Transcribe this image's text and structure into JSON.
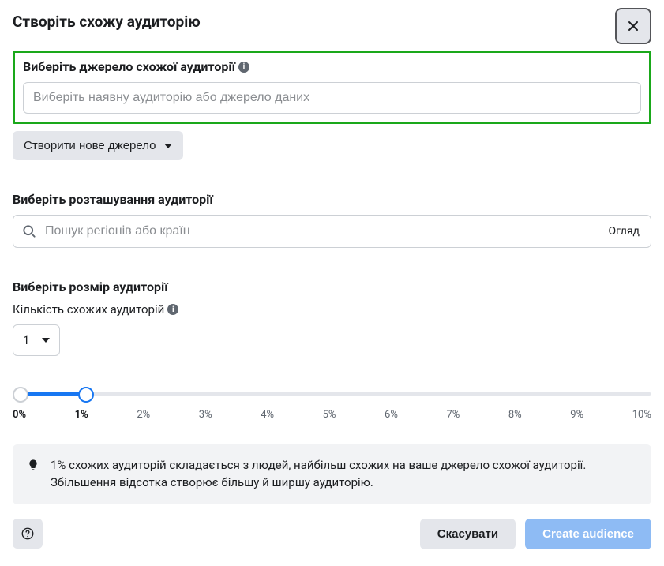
{
  "header": {
    "title": "Створіть схожу аудиторію"
  },
  "source": {
    "label": "Виберіть джерело схожої аудиторії",
    "placeholder": "Виберіть наявну аудиторію або джерело даних",
    "create_new_label": "Створити нове джерело"
  },
  "location": {
    "label": "Виберіть розташування аудиторії",
    "placeholder": "Пошук регіонів або країн",
    "browse_label": "Огляд"
  },
  "size": {
    "label": "Виберіть розмір аудиторії",
    "count_label": "Кількість схожих аудиторій",
    "count_value": "1",
    "ticks": [
      "0%",
      "1%",
      "2%",
      "3%",
      "4%",
      "5%",
      "6%",
      "7%",
      "8%",
      "9%",
      "10%"
    ],
    "bold_ticks": [
      0,
      1
    ]
  },
  "tip": {
    "text": "1% схожих аудиторій складається з людей, найбільш схожих на ваше джерело схожої аудиторії. Збільшення відсотка створює більшу й ширшу аудиторію."
  },
  "footer": {
    "cancel": "Скасувати",
    "create": "Create audience"
  }
}
